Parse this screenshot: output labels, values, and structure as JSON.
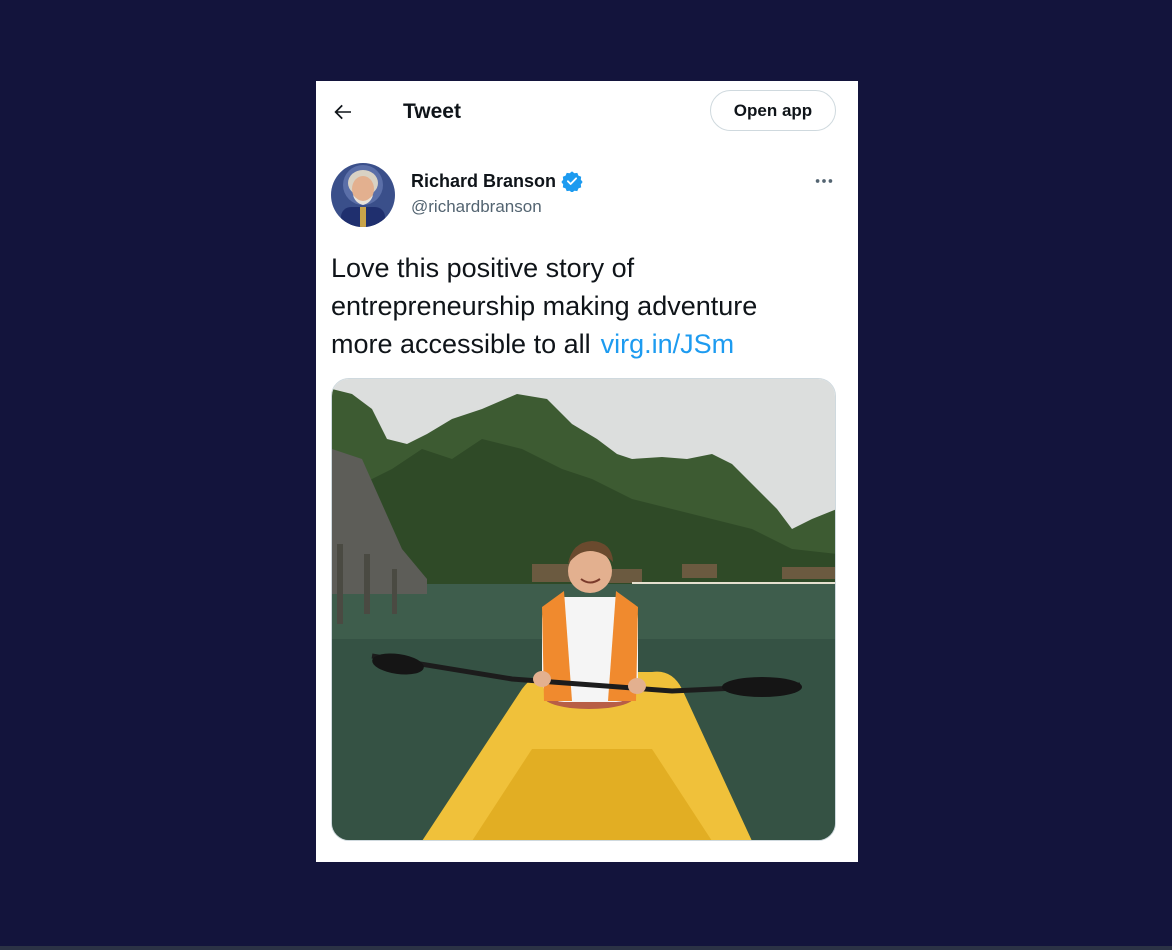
{
  "header": {
    "title": "Tweet",
    "open_app_label": "Open app"
  },
  "tweet": {
    "author_name": "Richard Branson",
    "author_handle": "@richardbranson",
    "text_lines": [
      "Love this positive story of",
      "entrepreneurship making adventure",
      "more accessible to all"
    ],
    "link_text": "virg.in/JSm"
  },
  "icons": {
    "back": "arrow-left-icon",
    "verified": "verified-badge-icon",
    "more": "more-horizontal-icon"
  },
  "colors": {
    "page_background": "#13143c",
    "link": "#1d9bf0",
    "verified": "#1d9bf0",
    "text_primary": "#0f1419",
    "text_secondary": "#536471"
  }
}
